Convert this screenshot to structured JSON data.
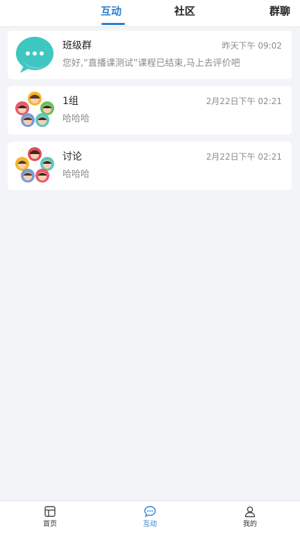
{
  "top_tabs": [
    {
      "label": "互动",
      "active": true
    },
    {
      "label": "社区",
      "active": false
    },
    {
      "label": "群聊",
      "active": false
    }
  ],
  "conversations": [
    {
      "name": "班级群",
      "time": "昨天下午 09:02",
      "preview": "您好,“直播课测试”课程已结束,马上去评价吧",
      "avatar": "chat-bubble-icon"
    },
    {
      "name": "1组",
      "time": "2月22日下午 02:21",
      "preview": "哈哈哈",
      "avatar": "group-avatar-icon"
    },
    {
      "name": "讨论",
      "time": "2月22日下午 02:21",
      "preview": "哈哈哈",
      "avatar": "group-avatar-icon"
    }
  ],
  "bottom_nav": [
    {
      "label": "首页",
      "icon": "home-icon",
      "active": false
    },
    {
      "label": "互动",
      "icon": "chat-icon",
      "active": true
    },
    {
      "label": "我的",
      "icon": "user-icon",
      "active": false
    }
  ],
  "colors": {
    "accent": "#2c7fcf",
    "background": "#f3f4f7",
    "chat_avatar": "#3ec6c0"
  }
}
